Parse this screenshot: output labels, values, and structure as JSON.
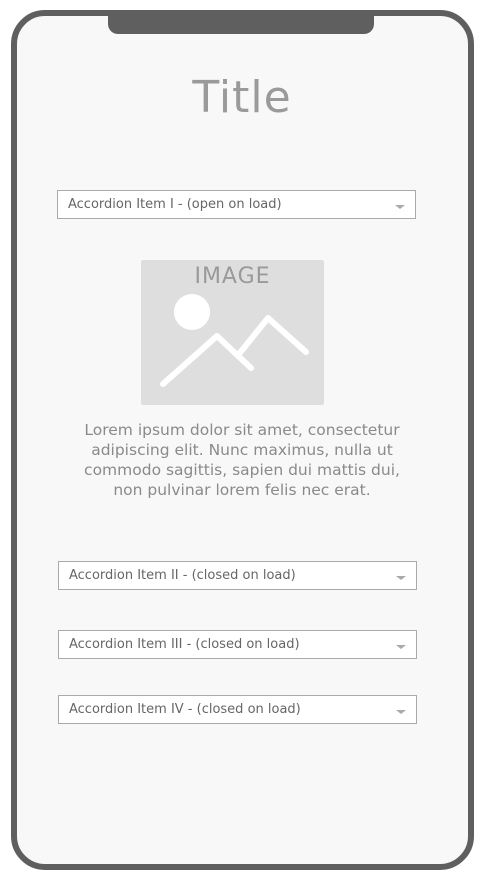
{
  "page": {
    "title": "Title"
  },
  "accordions": [
    {
      "label": "Accordion Item I - (open on load)"
    },
    {
      "label": "Accordion Item II - (closed on load)"
    },
    {
      "label": "Accordion Item III  - (closed on load)"
    },
    {
      "label": "Accordion Item IV - (closed on load)"
    }
  ],
  "content": {
    "image_label": "IMAGE",
    "image_icon": "image-placeholder-icon",
    "paragraph": "Lorem ipsum dolor sit amet, consectetur adipiscing elit. Nunc maximus, nulla ut commodo sagittis, sapien dui mattis dui, non pulvinar lorem felis nec erat."
  },
  "colors": {
    "frame": "#5f5f5f",
    "screen": "#f8f8f8",
    "placeholder": "#dedede",
    "text": "#666666",
    "border": "#aaaaaa"
  }
}
